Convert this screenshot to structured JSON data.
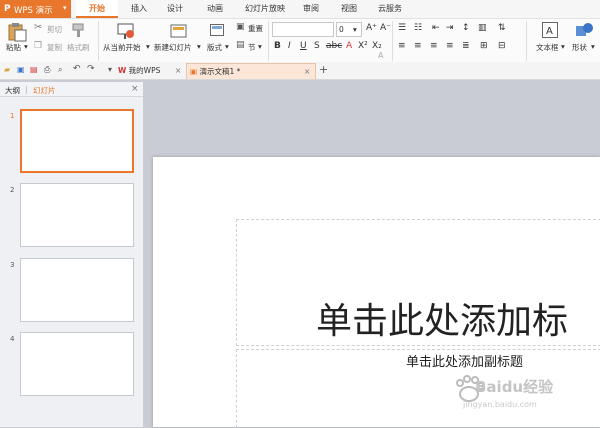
{
  "app": {
    "name": "WPS 演示",
    "logo": "P"
  },
  "menu_tabs": [
    "开始",
    "插入",
    "设计",
    "动画",
    "幻灯片放映",
    "审阅",
    "视图",
    "云服务"
  ],
  "ribbon": {
    "paste": "粘贴",
    "cut": "剪切",
    "copy": "复制",
    "format_painter": "格式刷",
    "from_current": "从当前开始",
    "new_slide": "新建幻灯片",
    "layout": "版式",
    "section": "节",
    "reset": "重置",
    "font_size": "0",
    "textbox": "文本框",
    "shape": "形状"
  },
  "doc_tabs": {
    "my_wps": "我的WPS",
    "current": "演示文稿1 *"
  },
  "left_panel": {
    "outline": "大纲",
    "divider": "|",
    "slides": "幻灯片",
    "slide_numbers": [
      "1",
      "2",
      "3",
      "4"
    ]
  },
  "slide": {
    "title": "单击此处添加标",
    "subtitle": "单击此处添加副标题"
  },
  "watermark": {
    "brand": "Baidu经验",
    "url": "jingyan.baidu.com"
  },
  "colors": {
    "accent": "#e8762b",
    "canvas": "#c9ccd3"
  }
}
